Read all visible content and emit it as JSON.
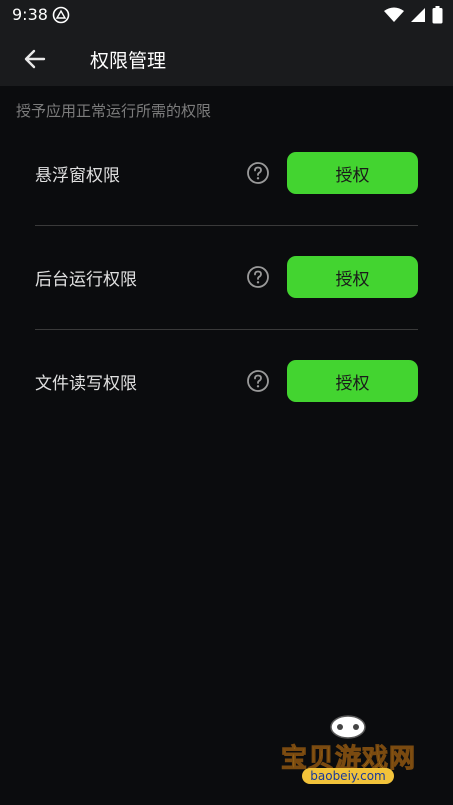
{
  "status_bar": {
    "time": "9:38",
    "icons": [
      "app-notification-icon",
      "wifi-icon",
      "signal-icon",
      "battery-icon"
    ]
  },
  "app_bar": {
    "title": "权限管理",
    "back_icon": "arrow-left-icon"
  },
  "subtitle": "授予应用正常运行所需的权限",
  "permissions": [
    {
      "label": "悬浮窗权限",
      "button_label": "授权"
    },
    {
      "label": "后台运行权限",
      "button_label": "授权"
    },
    {
      "label": "文件读写权限",
      "button_label": "授权"
    }
  ],
  "colors": {
    "background": "#0b0c0e",
    "bar": "#1a1b1d",
    "accent": "#43d430",
    "subtitle": "#7c7c7c"
  },
  "watermark": {
    "text": "宝贝游戏网",
    "url": "baobeiy.com"
  }
}
